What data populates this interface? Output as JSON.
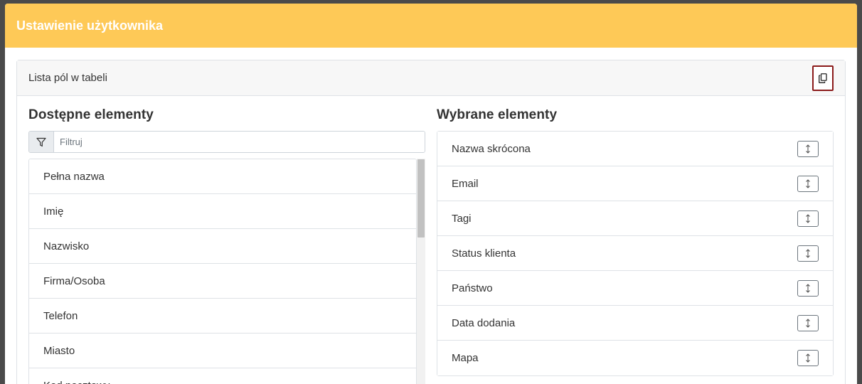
{
  "modal": {
    "title": "Ustawienie użytkownika"
  },
  "card": {
    "title": "Lista pól w tabeli",
    "copy_icon": "copy-icon"
  },
  "available": {
    "heading": "Dostępne elementy",
    "filter_placeholder": "Filtruj",
    "filter_icon": "filter-icon",
    "items": [
      "Pełna nazwa",
      "Imię",
      "Nazwisko",
      "Firma/Osoba",
      "Telefon",
      "Miasto",
      "Kod pocztowy"
    ]
  },
  "selected": {
    "heading": "Wybrane elementy",
    "move_icon": "arrows-vertical-icon",
    "items": [
      "Nazwa skrócona",
      "Email",
      "Tagi",
      "Status klienta",
      "Państwo",
      "Data dodania",
      "Mapa"
    ]
  },
  "colors": {
    "header_bg": "#fec957",
    "header_text": "#ffffff",
    "copy_button_border": "#8b1a1a"
  }
}
